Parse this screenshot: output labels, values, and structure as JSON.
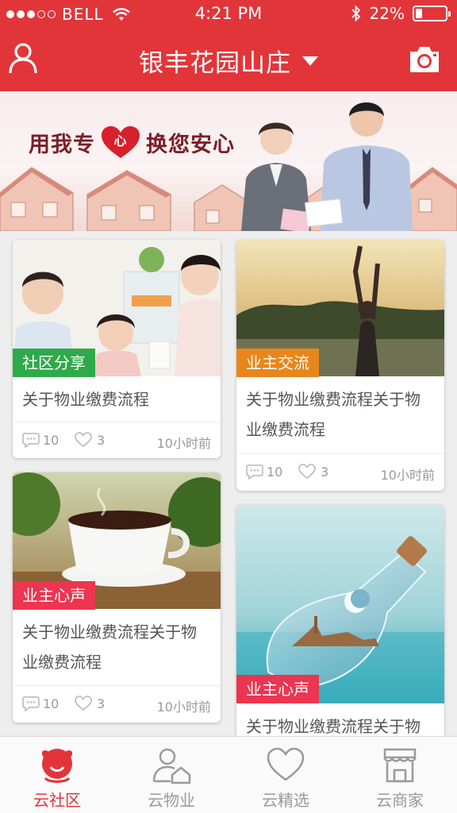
{
  "status_bar": {
    "carrier": "BELL",
    "time": "4:21 PM",
    "battery": "22%",
    "battery_level": 0.22
  },
  "header": {
    "title": "银丰花园山庄"
  },
  "banner": {
    "slogan_left": "用我专",
    "slogan_heart": "心",
    "slogan_right": "换您安心"
  },
  "feed": {
    "cards": [
      {
        "tag": "社区分享",
        "tag_color": "#2eaa4a",
        "text": "关于物业缴费流程",
        "comments": "10",
        "likes": "3",
        "time": "10小时前"
      },
      {
        "tag": "业主交流",
        "tag_color": "#e8861c",
        "text": "关于物业缴费流程关于物业缴费流程",
        "comments": "10",
        "likes": "3",
        "time": "10小时前"
      },
      {
        "tag": "业主心声",
        "tag_color": "#ec3550",
        "text": "关于物业缴费流程关于物业缴费流程",
        "comments": "10",
        "likes": "3",
        "time": "10小时前"
      },
      {
        "tag": "业主心声",
        "tag_color": "#ec3550",
        "text": "关于物业缴费流程关于物",
        "comments": "",
        "likes": "",
        "time": ""
      }
    ]
  },
  "tabbar": {
    "tabs": [
      {
        "label": "云社区",
        "icon": "community-icon",
        "active": true
      },
      {
        "label": "云物业",
        "icon": "property-icon",
        "active": false
      },
      {
        "label": "云精选",
        "icon": "heart-icon",
        "active": false
      },
      {
        "label": "云商家",
        "icon": "store-icon",
        "active": false
      }
    ]
  },
  "colors": {
    "brand_red": "#e2353a",
    "tab_inactive": "#9a9a9a"
  }
}
